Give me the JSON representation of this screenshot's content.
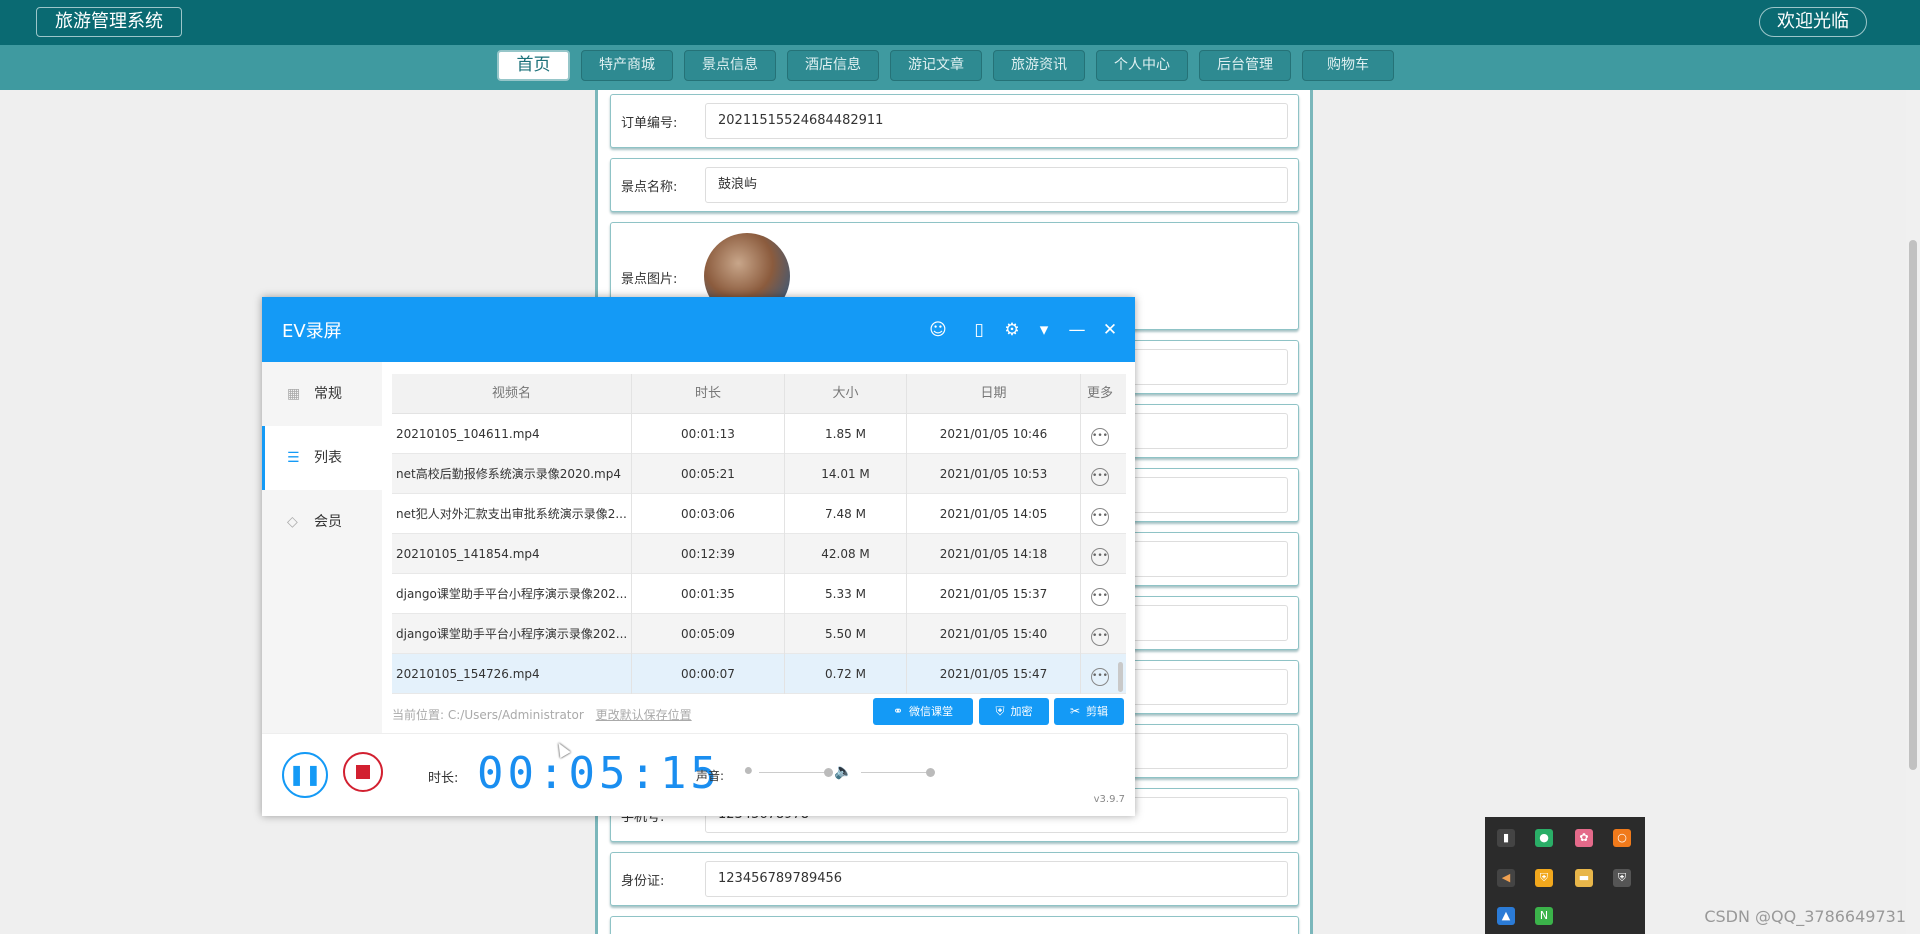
{
  "app": {
    "brand": "旅游管理系统",
    "welcome": "欢迎光临"
  },
  "nav": [
    {
      "label": "首页",
      "active": true
    },
    {
      "label": "特产商城"
    },
    {
      "label": "景点信息"
    },
    {
      "label": "酒店信息"
    },
    {
      "label": "游记文章"
    },
    {
      "label": "旅游资讯"
    },
    {
      "label": "个人中心"
    },
    {
      "label": "后台管理"
    },
    {
      "label": "购物车"
    }
  ],
  "form": {
    "order_no_label": "订单编号:",
    "order_no": "20211515524684482911",
    "spot_name_label": "景点名称:",
    "spot_name": "鼓浪屿",
    "spot_image_label": "景点图片:",
    "phone_label": "手机号:",
    "phone": "12345678978",
    "id_label": "身份证:",
    "id_no": "123456789789456"
  },
  "recorder": {
    "title": "EV录屏",
    "sidebar": [
      {
        "label": "常规",
        "icon": "grid-icon"
      },
      {
        "label": "列表",
        "icon": "list-icon",
        "active": true
      },
      {
        "label": "会员",
        "icon": "diamond-icon"
      }
    ],
    "columns": [
      "视频名",
      "时长",
      "大小",
      "日期",
      "更多"
    ],
    "rows": [
      {
        "name": "20210105_104611.mp4",
        "duration": "00:01:13",
        "size": "1.85 M",
        "date": "2021/01/05 10:46"
      },
      {
        "name": "net高校后勤报修系统演示录像2020.mp4",
        "duration": "00:05:21",
        "size": "14.01 M",
        "date": "2021/01/05 10:53"
      },
      {
        "name": "net犯人对外汇款支出审批系统演示录像2...",
        "duration": "00:03:06",
        "size": "7.48 M",
        "date": "2021/01/05 14:05"
      },
      {
        "name": "20210105_141854.mp4",
        "duration": "00:12:39",
        "size": "42.08 M",
        "date": "2021/01/05 14:18"
      },
      {
        "name": "django课堂助手平台小程序演示录像202...",
        "duration": "00:01:35",
        "size": "5.33 M",
        "date": "2021/01/05 15:37"
      },
      {
        "name": "django课堂助手平台小程序演示录像202...",
        "duration": "00:05:09",
        "size": "5.50 M",
        "date": "2021/01/05 15:40"
      },
      {
        "name": "20210105_154726.mp4",
        "duration": "00:00:07",
        "size": "0.72 M",
        "date": "2021/01/05 15:47",
        "selected": true
      }
    ],
    "location_label": "当前位置:",
    "location_path": "C:/Users/Administrator",
    "change_location": "更改默认保存位置",
    "buttons": {
      "wechat": "微信课堂",
      "encrypt": "加密",
      "edit": "剪辑"
    },
    "duration_label": "时长:",
    "timer": "00:05:15",
    "sound_label": "声音:",
    "version": "v3.9.7"
  },
  "watermark": "CSDN @QQ_3786649731"
}
